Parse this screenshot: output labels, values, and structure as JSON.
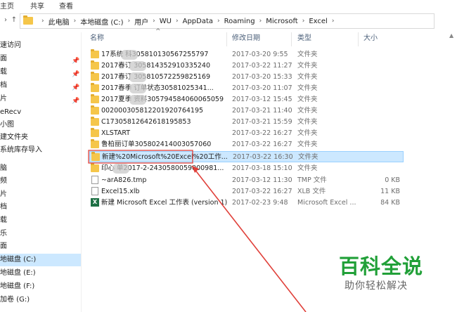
{
  "ribbon": {
    "tabs": [
      "主页",
      "共享",
      "查看"
    ]
  },
  "address_bar": {
    "crumbs": [
      "此电脑",
      "本地磁盘 (C:)",
      "用户",
      "WU",
      "AppData",
      "Roaming",
      "Microsoft",
      "Excel"
    ]
  },
  "nav_pane": {
    "items": [
      {
        "label": "速访问",
        "pinned": false
      },
      {
        "label": "面",
        "pinned": true
      },
      {
        "label": "载",
        "pinned": true
      },
      {
        "label": "档",
        "pinned": true
      },
      {
        "label": "片",
        "pinned": true
      },
      {
        "label": "eRecv",
        "pinned": false
      },
      {
        "label": "小图",
        "pinned": false
      },
      {
        "label": "建文件夹",
        "pinned": false
      },
      {
        "label": "系统库存导入",
        "pinned": false
      },
      {
        "label": "脑",
        "pinned": false
      },
      {
        "label": "频",
        "pinned": false
      },
      {
        "label": "片",
        "pinned": false
      },
      {
        "label": "档",
        "pinned": false
      },
      {
        "label": "载",
        "pinned": false
      },
      {
        "label": "乐",
        "pinned": false
      },
      {
        "label": "面",
        "pinned": false
      },
      {
        "label": "地磁盘 (C:)",
        "pinned": false,
        "selected": true
      },
      {
        "label": "地磁盘 (E:)",
        "pinned": false
      },
      {
        "label": "地磁盘 (F:)",
        "pinned": false
      },
      {
        "label": "加卷 (G:)",
        "pinned": false
      }
    ]
  },
  "columns": {
    "name": "名称",
    "modified": "修改日期",
    "type": "类型",
    "size": "大小"
  },
  "files": [
    {
      "name": "17系统  科305810130567255797",
      "date": "2017-03-20 9:55",
      "type": "文件夹",
      "size": "",
      "icon": "folder-icon"
    },
    {
      "name": "2017春订  305814352910335240",
      "date": "2017-03-22 11:27",
      "type": "文件夹",
      "size": "",
      "icon": "folder-icon"
    },
    {
      "name": "2017春订  305810572259825169",
      "date": "2017-03-20 15:33",
      "type": "文件夹",
      "size": "",
      "icon": "folder-icon"
    },
    {
      "name": "2017春季  订单状态30581025341...",
      "date": "2017-03-20 11:07",
      "type": "文件夹",
      "size": "",
      "icon": "folder-icon"
    },
    {
      "name": "2017夏季  资料305794584060065059",
      "date": "2017-03-12 15:45",
      "type": "文件夹",
      "size": "",
      "icon": "folder-icon"
    },
    {
      "name": "00200030581220192076419​5",
      "date": "2017-03-21 11:40",
      "type": "文件夹",
      "size": "",
      "icon": "folder-icon"
    },
    {
      "name": "C17305812642618195853",
      "date": "2017-03-21 15:59",
      "type": "文件夹",
      "size": "",
      "icon": "folder-icon"
    },
    {
      "name": "XLSTART",
      "date": "2017-03-22 16:27",
      "type": "文件夹",
      "size": "",
      "icon": "folder-icon"
    },
    {
      "name": "鲁柏丽订单305802414003057060",
      "date": "2017-03-22 16:27",
      "type": "文件夹",
      "size": "",
      "icon": "folder-icon"
    },
    {
      "name": "新建%20Microsoft%20Excel%20工作...",
      "date": "2017-03-22 16:30",
      "type": "文件夹",
      "size": "",
      "icon": "folder-icon",
      "selected": true
    },
    {
      "name": "印心  单2017-2-2430580059000981...",
      "date": "2017-03-18 15:10",
      "type": "文件夹",
      "size": "",
      "icon": "folder-icon"
    },
    {
      "name": "~arA826.tmp",
      "date": "2017-03-12 11:30",
      "type": "TMP 文件",
      "size": "0 KB",
      "icon": "file-icon"
    },
    {
      "name": "Excel15.xlb",
      "date": "2017-03-22 16:27",
      "type": "XLB 文件",
      "size": "11 KB",
      "icon": "file-icon"
    },
    {
      "name": "新建 Microsoft Excel 工作表 (version 1)",
      "date": "2017-02-23 9:48",
      "type": "Microsoft Excel ...",
      "size": "84 KB",
      "icon": "excel-icon"
    }
  ],
  "watermark": {
    "logo": "百科全说",
    "subtitle": "助你轻松解决"
  },
  "colors": {
    "selection": "#cce8ff",
    "folder": "#f5c64a",
    "annotation_red": "#e0403a",
    "watermark_green": "#21a038"
  }
}
